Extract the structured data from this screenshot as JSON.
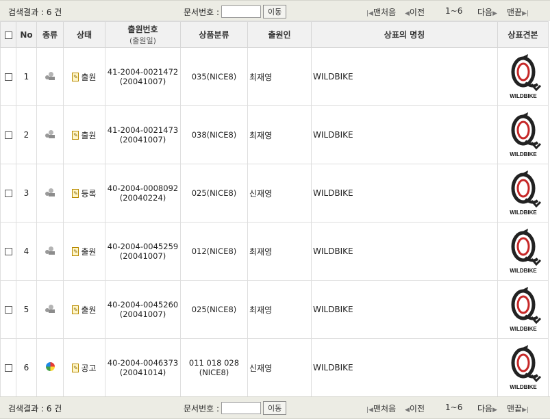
{
  "summary": {
    "count_label": "검색결과 : 6 건"
  },
  "doc_search": {
    "label": "문서번호 :",
    "value": "",
    "go_label": "이동"
  },
  "pager": {
    "first": "맨처음",
    "prev": "이전",
    "range": "1~6",
    "next": "다음",
    "last": "맨끝"
  },
  "headers": {
    "no": "No",
    "kind": "종류",
    "status": "상태",
    "app_no": "출원번호",
    "app_no_sub": "(출원일)",
    "class": "상품분류",
    "applicant": "출원인",
    "name": "상표의 명칭",
    "sample": "상표견본"
  },
  "rows": [
    {
      "no": "1",
      "kind_icon": "person-icon",
      "status": "출원",
      "app_no": "41-2004-0021472",
      "app_date": "(20041007)",
      "class": "035(NICE8)",
      "class2": "",
      "applicant": "최재영",
      "name": "WILDBIKE",
      "sample_text": "WILDBIKE"
    },
    {
      "no": "2",
      "kind_icon": "person-icon",
      "status": "출원",
      "app_no": "41-2004-0021473",
      "app_date": "(20041007)",
      "class": "038(NICE8)",
      "class2": "",
      "applicant": "최재영",
      "name": "WILDBIKE",
      "sample_text": "WILDBIKE"
    },
    {
      "no": "3",
      "kind_icon": "person-icon",
      "status": "등록",
      "app_no": "40-2004-0008092",
      "app_date": "(20040224)",
      "class": "025(NICE8)",
      "class2": "",
      "applicant": "신재영",
      "name": "WILDBIKE",
      "sample_text": "WILDBIKE"
    },
    {
      "no": "4",
      "kind_icon": "person-icon",
      "status": "출원",
      "app_no": "40-2004-0045259",
      "app_date": "(20041007)",
      "class": "012(NICE8)",
      "class2": "",
      "applicant": "최재영",
      "name": "WILDBIKE",
      "sample_text": "WILDBIKE"
    },
    {
      "no": "5",
      "kind_icon": "person-icon",
      "status": "출원",
      "app_no": "40-2004-0045260",
      "app_date": "(20041007)",
      "class": "025(NICE8)",
      "class2": "",
      "applicant": "최재영",
      "name": "WILDBIKE",
      "sample_text": "WILDBIKE"
    },
    {
      "no": "6",
      "kind_icon": "color-wheel-icon",
      "status": "공고",
      "app_no": "40-2004-0046373",
      "app_date": "(20041014)",
      "class": "011 018 028",
      "class2": "(NICE8)",
      "applicant": "신재영",
      "name": "WILDBIKE",
      "sample_text": "WILDBIKE"
    }
  ]
}
